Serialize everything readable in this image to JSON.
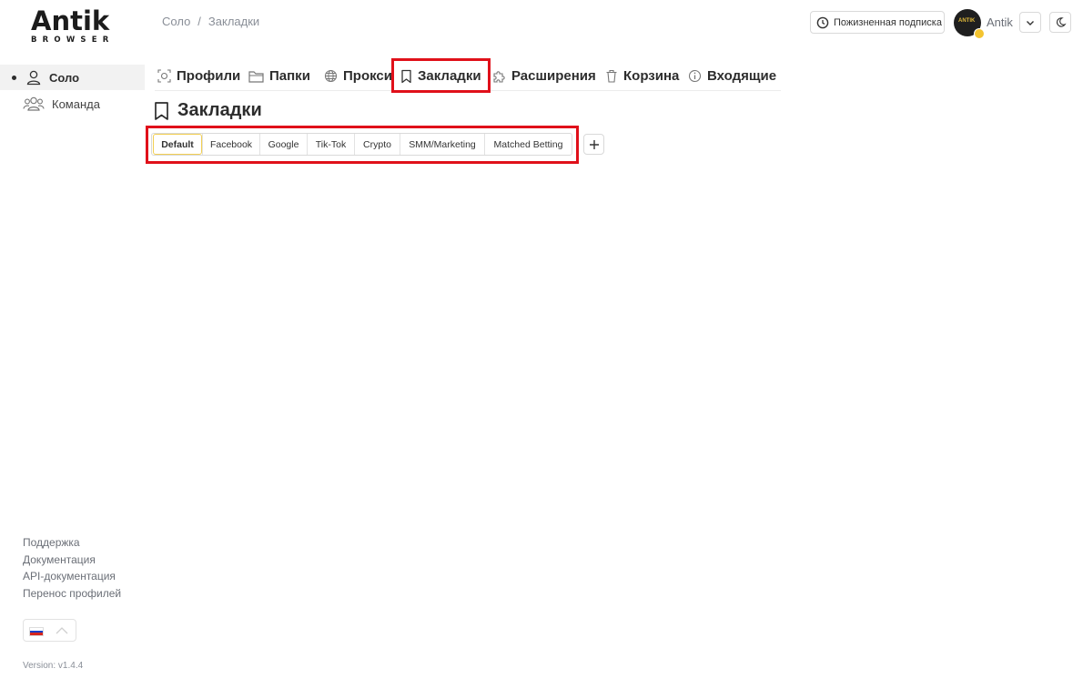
{
  "logo": {
    "word": "Antik",
    "sub": "BROWSER"
  },
  "breadcrumb": {
    "first": "Соло",
    "sep": "/",
    "current": "Закладки"
  },
  "header": {
    "subscription_label": "Пожизненная подписка",
    "user_name": "Antik",
    "avatar_text": "ANTIK"
  },
  "sidebar": {
    "items": [
      {
        "label": "Соло",
        "icon": "user-icon",
        "active": true
      },
      {
        "label": "Команда",
        "icon": "users-icon",
        "active": false
      }
    ],
    "footer_links": [
      "Поддержка",
      "Документация",
      "API-документация",
      "Перенос профилей"
    ],
    "language": "ru",
    "version": "Version: v1.4.4"
  },
  "tabs": [
    {
      "label": "Профили",
      "icon": "profile-scan-icon"
    },
    {
      "label": "Папки",
      "icon": "folder-icon"
    },
    {
      "label": "Прокси",
      "icon": "globe-icon"
    },
    {
      "label": "Закладки",
      "icon": "bookmark-icon",
      "active": true
    },
    {
      "label": "Расширения",
      "icon": "puzzle-icon"
    },
    {
      "label": "Корзина",
      "icon": "trash-icon"
    },
    {
      "label": "Входящие",
      "icon": "info-icon"
    }
  ],
  "page": {
    "title": "Закладки"
  },
  "bookmark_folders": [
    "Default",
    "Facebook",
    "Google",
    "Tik-Tok",
    "Crypto",
    "SMM/Marketing",
    "Matched Betting"
  ],
  "colors": {
    "highlight": "#e0101a",
    "active_folder_border": "#f2cf52",
    "accent": "#f4c430"
  }
}
